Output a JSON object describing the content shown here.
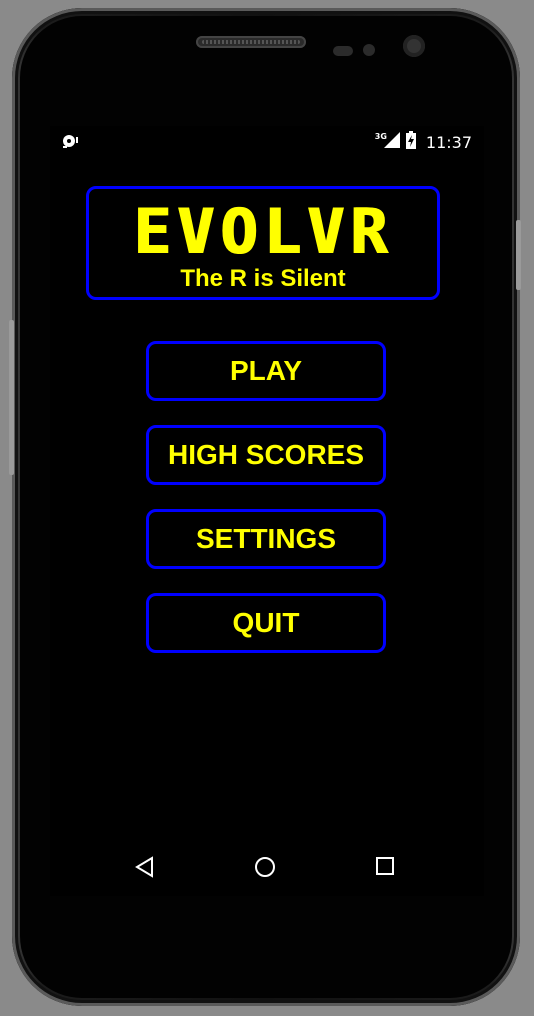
{
  "status_bar": {
    "left_icon": "debug-notification-icon",
    "network_type": "3G",
    "signal_icon": "cell-signal-icon",
    "battery_icon": "battery-charging-icon",
    "time": "11:37"
  },
  "header": {
    "title": "EVOLVR",
    "subtitle": "The R is Silent"
  },
  "menu": {
    "items": [
      {
        "label": "PLAY"
      },
      {
        "label": "HIGH SCORES"
      },
      {
        "label": "SETTINGS"
      },
      {
        "label": "QUIT"
      }
    ]
  },
  "nav_bar": {
    "back_icon": "back-triangle-icon",
    "home_icon": "home-circle-icon",
    "recents_icon": "recents-square-icon"
  },
  "colors": {
    "accent": "#ffff00",
    "border": "#0000ff",
    "background": "#000000"
  }
}
